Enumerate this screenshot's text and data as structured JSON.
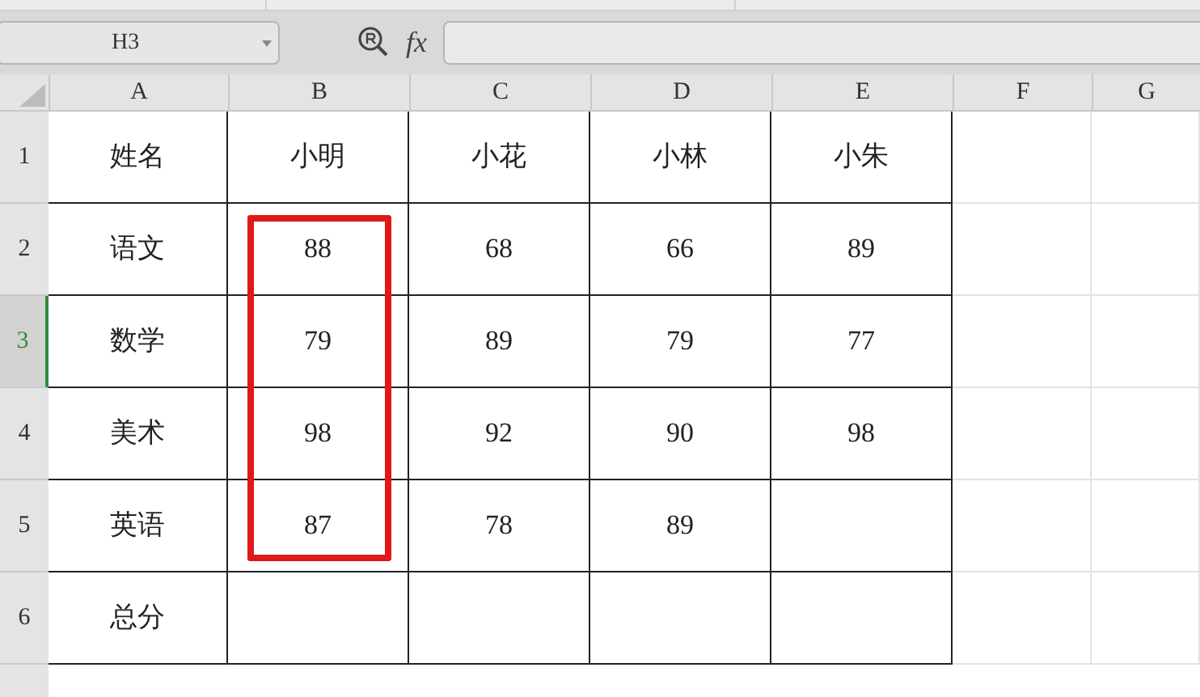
{
  "name_box": {
    "value": "H3"
  },
  "formula_bar": {
    "fx_label": "fx"
  },
  "columns": [
    {
      "label": "A"
    },
    {
      "label": "B"
    },
    {
      "label": "C"
    },
    {
      "label": "D"
    },
    {
      "label": "E"
    },
    {
      "label": "F"
    },
    {
      "label": "G"
    }
  ],
  "rows": [
    {
      "number": "1",
      "selected": false,
      "cells": [
        {
          "text": "姓名",
          "highlighted": false
        },
        {
          "text": "小明",
          "highlighted": false
        },
        {
          "text": "小花",
          "highlighted": false
        },
        {
          "text": "小林",
          "highlighted": false
        },
        {
          "text": "小朱",
          "highlighted": false
        }
      ]
    },
    {
      "number": "2",
      "selected": false,
      "cells": [
        {
          "text": "语文",
          "highlighted": false
        },
        {
          "text": "88",
          "highlighted": true
        },
        {
          "text": "68",
          "highlighted": false
        },
        {
          "text": "66",
          "highlighted": false
        },
        {
          "text": "89",
          "highlighted": false
        }
      ]
    },
    {
      "number": "3",
      "selected": true,
      "cells": [
        {
          "text": "数学",
          "highlighted": false
        },
        {
          "text": "79",
          "highlighted": true
        },
        {
          "text": "89",
          "highlighted": false
        },
        {
          "text": "79",
          "highlighted": false
        },
        {
          "text": "77",
          "highlighted": false
        }
      ]
    },
    {
      "number": "4",
      "selected": false,
      "cells": [
        {
          "text": "美术",
          "highlighted": false
        },
        {
          "text": "98",
          "highlighted": true
        },
        {
          "text": "92",
          "highlighted": false
        },
        {
          "text": "90",
          "highlighted": false
        },
        {
          "text": "98",
          "highlighted": false
        }
      ]
    },
    {
      "number": "5",
      "selected": false,
      "cells": [
        {
          "text": "英语",
          "highlighted": false
        },
        {
          "text": "87",
          "highlighted": true
        },
        {
          "text": "78",
          "highlighted": false
        },
        {
          "text": "89",
          "highlighted": false
        },
        {
          "highlighted": false
        }
      ]
    },
    {
      "number": "6",
      "selected": false,
      "cells": [
        {
          "text": "总分",
          "highlighted": false
        },
        {
          "highlighted": false
        },
        {
          "highlighted": false
        },
        {
          "highlighted": false
        },
        {
          "highlighted": false
        }
      ]
    }
  ]
}
